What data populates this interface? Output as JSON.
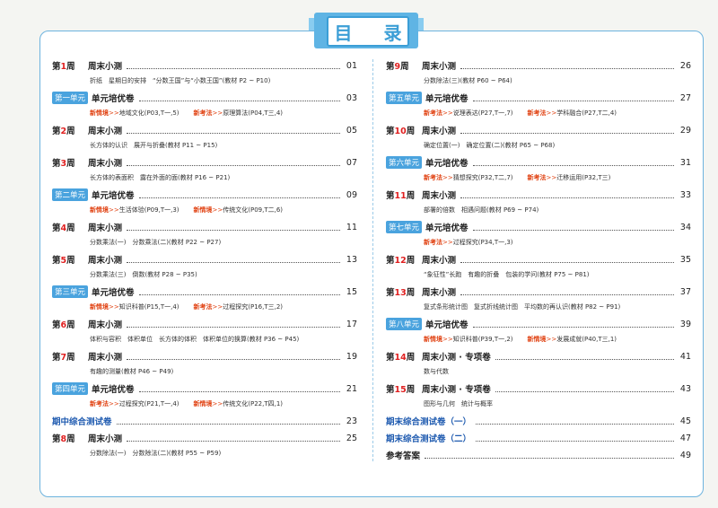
{
  "title": "目 录",
  "left": [
    {
      "week": "第",
      "num": "1",
      "unit_word": "周",
      "title": "周末小测",
      "page": "01",
      "sub": "折纸　星期日的安排　“分数王国”与“小数王国”(教材 P2 ~ P10)"
    },
    {
      "badge": "第一单元",
      "title": "单元培优卷",
      "page": "03",
      "tags": [
        {
          "tag": "新情境",
          "text": "地域文化(P03,T一,5)"
        },
        {
          "tag": "新考法",
          "text": "原理算法(P04,T三,4)"
        }
      ]
    },
    {
      "week": "第",
      "num": "2",
      "unit_word": "周",
      "title": "周末小测",
      "page": "05",
      "sub": "长方体的认识　展开与折叠(教材 P11 ~ P15)"
    },
    {
      "week": "第",
      "num": "3",
      "unit_word": "周",
      "title": "周末小测",
      "page": "07",
      "sub": "长方体的表面积　露在外面的面(教材 P16 ~ P21)"
    },
    {
      "badge": "第二单元",
      "title": "单元培优卷",
      "page": "09",
      "tags": [
        {
          "tag": "新情境",
          "text": "生活体验(P09,T一,3)"
        },
        {
          "tag": "新情境",
          "text": "传统文化(P09,T二,6)"
        }
      ]
    },
    {
      "week": "第",
      "num": "4",
      "unit_word": "周",
      "title": "周末小测",
      "page": "11",
      "sub": "分数乘法(一)　分数乘法(二)(教材 P22 ~ P27)"
    },
    {
      "week": "第",
      "num": "5",
      "unit_word": "周",
      "title": "周末小测",
      "page": "13",
      "sub": "分数乘法(三)　倒数(教材 P28 ~ P35)"
    },
    {
      "badge": "第三单元",
      "title": "单元培优卷",
      "page": "15",
      "tags": [
        {
          "tag": "新情境",
          "text": "知识科普(P15,T一,4)"
        },
        {
          "tag": "新考法",
          "text": "过程探究(P16,T三,2)"
        }
      ]
    },
    {
      "week": "第",
      "num": "6",
      "unit_word": "周",
      "title": "周末小测",
      "page": "17",
      "sub": "体积与容积　体积单位　长方体的体积　体积单位的换算(教材 P36 ~ P45)"
    },
    {
      "week": "第",
      "num": "7",
      "unit_word": "周",
      "title": "周末小测",
      "page": "19",
      "sub": "有趣的测量(教材 P46 ~ P49)"
    },
    {
      "badge": "第四单元",
      "title": "单元培优卷",
      "page": "21",
      "tags": [
        {
          "tag": "新考法",
          "text": "过程探究(P21,T一,4)"
        },
        {
          "tag": "新情境",
          "text": "传统文化(P22,T四,1)"
        }
      ]
    },
    {
      "plain": "期中综合测试卷",
      "page": "23"
    },
    {
      "week": "第",
      "num": "8",
      "unit_word": "周",
      "title": "周末小测",
      "page": "25",
      "sub": "分数除法(一)　分数除法(二)(教材 P55 ~ P59)"
    }
  ],
  "right": [
    {
      "week": "第",
      "num": "9",
      "unit_word": "周",
      "title": "周末小测",
      "page": "26",
      "sub": "分数除法(三)(教材 P60 ~ P64)"
    },
    {
      "badge": "第五单元",
      "title": "单元培优卷",
      "page": "27",
      "tags": [
        {
          "tag": "新考法",
          "text": "说理表达(P27,T一,7)"
        },
        {
          "tag": "新考法",
          "text": "学科融合(P27,T二,4)"
        }
      ]
    },
    {
      "week": "第",
      "num": "10",
      "unit_word": "周",
      "title": "周末小测",
      "page": "29",
      "sub": "确定位置(一)　确定位置(二)(教材 P65 ~ P68)"
    },
    {
      "badge": "第六单元",
      "title": "单元培优卷",
      "page": "31",
      "tags": [
        {
          "tag": "新考法",
          "text": "猜想探究(P32,T二,7)"
        },
        {
          "tag": "新考法",
          "text": "迁移运用(P32,T三)"
        }
      ]
    },
    {
      "week": "第",
      "num": "11",
      "unit_word": "周",
      "title": "周末小测",
      "page": "33",
      "sub": "部署的倍数　相遇问题(教材 P69 ~ P74)"
    },
    {
      "badge": "第七单元",
      "title": "单元培优卷",
      "page": "34",
      "tags": [
        {
          "tag": "新考法",
          "text": "过程探究(P34,T一,3)"
        }
      ]
    },
    {
      "week": "第",
      "num": "12",
      "unit_word": "周",
      "title": "周末小测",
      "page": "35",
      "sub": "“象征性”长跑　有趣的折叠　包装的学问(教材 P75 ~ P81)"
    },
    {
      "week": "第",
      "num": "13",
      "unit_word": "周",
      "title": "周末小测",
      "page": "37",
      "sub": "复式条形统计图　复式折线统计图　平均数的再认识(教材 P82 ~ P91)"
    },
    {
      "badge": "第八单元",
      "title": "单元培优卷",
      "page": "39",
      "tags": [
        {
          "tag": "新情境",
          "text": "知识科普(P39,T一,2)"
        },
        {
          "tag": "新情境",
          "text": "发展成就(P40,T三,1)"
        }
      ]
    },
    {
      "week": "第",
      "num": "14",
      "unit_word": "周",
      "title": "周末小测 · 专项卷",
      "page": "41",
      "sub": "数与代数"
    },
    {
      "week": "第",
      "num": "15",
      "unit_word": "周",
      "title": "周末小测 · 专项卷",
      "page": "43",
      "sub": "图形与几何　统计与概率"
    },
    {
      "plain": "期末综合测试卷（一）",
      "page": "45"
    },
    {
      "plain": "期末综合测试卷（二）",
      "page": "47"
    },
    {
      "plain_black": "参考答案",
      "page": "49"
    }
  ],
  "arrow": ">>"
}
